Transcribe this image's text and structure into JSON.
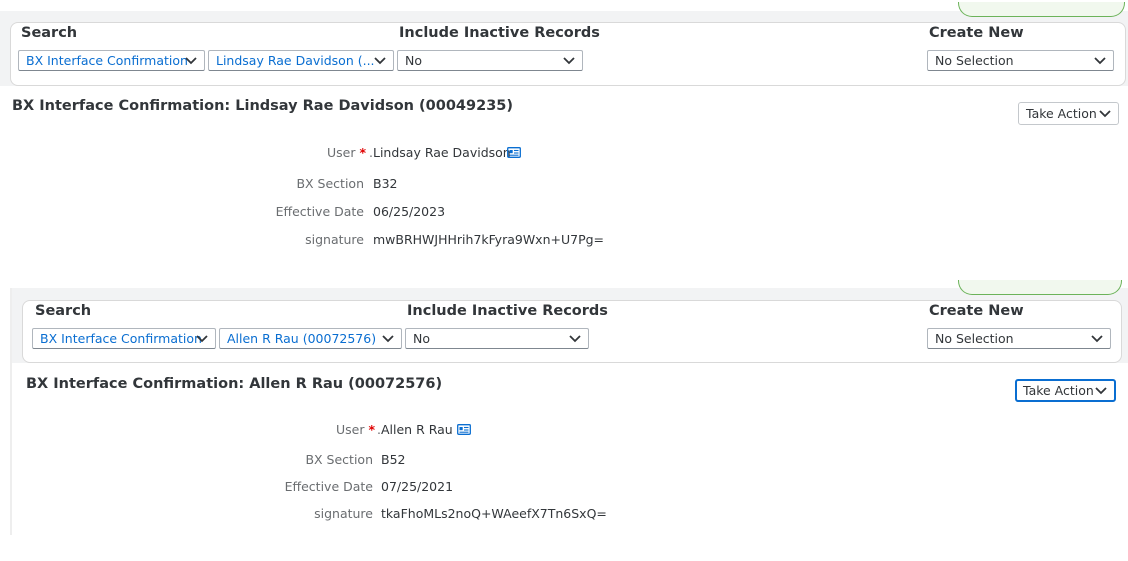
{
  "panels": [
    {
      "search": {
        "search_label": "Search",
        "inactive_label": "Include Inactive Records",
        "create_label": "Create New",
        "type_select": "BX Interface Confirmation",
        "user_select": "Lindsay Rae Davidson (...",
        "inactive_select": "No",
        "create_select": "No Selection"
      },
      "record": {
        "title": "BX Interface Confirmation: Lindsay Rae Davidson (00049235)",
        "take_action": "Take Action",
        "user_label": "User",
        "required_mark": "*",
        "user_value": "Lindsay Rae Davidson",
        "section_label": "BX Section",
        "section_value": "B32",
        "date_label": "Effective Date",
        "date_value": "06/25/2023",
        "signature_label": "signature",
        "signature_value": "mwBRHWJHHrih7kFyra9Wxn+U7Pg="
      }
    },
    {
      "search": {
        "search_label": "Search",
        "inactive_label": "Include Inactive Records",
        "create_label": "Create New",
        "type_select": "BX Interface Confirmation",
        "user_select": "Allen R Rau (00072576)",
        "inactive_select": "No",
        "create_select": "No Selection"
      },
      "record": {
        "title": "BX Interface Confirmation: Allen R Rau (00072576)",
        "take_action": "Take Action",
        "user_label": "User",
        "required_mark": "*",
        "user_value": "Allen R Rau",
        "section_label": "BX Section",
        "section_value": "B52",
        "date_label": "Effective Date",
        "date_value": "07/25/2021",
        "signature_label": "signature",
        "signature_value": "tkaFhoMLs2noQ+WAeefX7Tn6SxQ="
      }
    }
  ],
  "colors": {
    "link": "#0a6ed1",
    "required": "#e00000",
    "focus": "#0a6ed1",
    "pill_border": "#6cb35a"
  }
}
